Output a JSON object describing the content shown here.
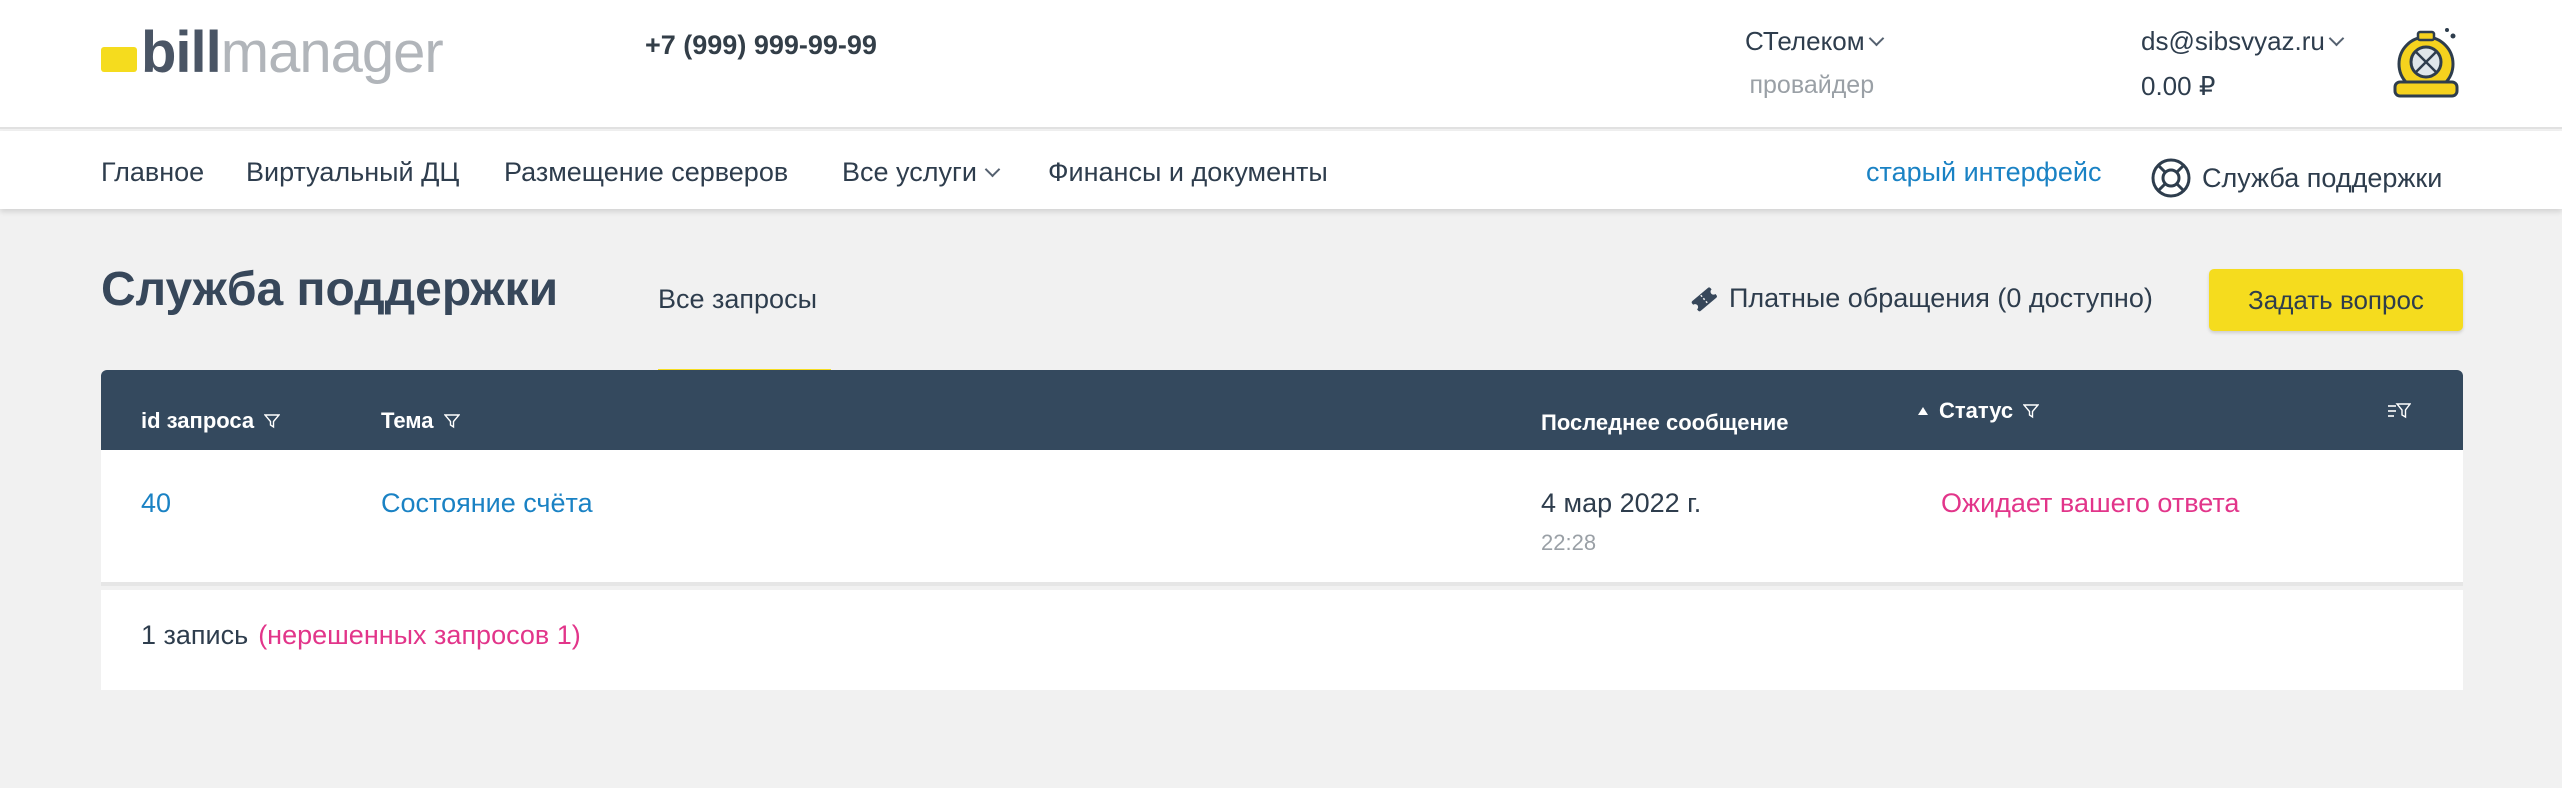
{
  "brand": {
    "logo_bill": "bill",
    "logo_manager": "manager",
    "accent": "#f5dc1e"
  },
  "header": {
    "phone": "+7 (999) 999-99-99",
    "provider_name": "СТелеком",
    "provider_sub": "провайдер",
    "account_email": "ds@sibsvyaz.ru",
    "account_balance": "0.00 ₽"
  },
  "nav": {
    "items": [
      {
        "label": "Главное"
      },
      {
        "label": "Виртуальный ДЦ"
      },
      {
        "label": "Размещение серверов"
      },
      {
        "label": "Все услуги"
      },
      {
        "label": "Финансы и документы"
      }
    ],
    "old_interface": "старый интерфейс",
    "support": "Служба поддержки"
  },
  "main": {
    "title": "Служба поддержки",
    "tab_all": "Все запросы",
    "paid_requests": "Платные обращения (0 доступно)",
    "ask_button": "Задать вопрос"
  },
  "table": {
    "columns": {
      "id": "id запроса",
      "subject": "Тема",
      "last_message": "Последнее сообщение",
      "status": "Статус"
    },
    "rows": [
      {
        "id": "40",
        "subject": "Состояние счёта",
        "date": "4 мар 2022 г.",
        "time": "22:28",
        "status": "Ожидает вашего ответа"
      }
    ],
    "footer_count": "1  запись",
    "footer_unresolved": "(нерешенных запросов 1)"
  },
  "colors": {
    "header_dark": "#34495e",
    "link": "#1a82c4",
    "status_pink": "#e2358a"
  }
}
